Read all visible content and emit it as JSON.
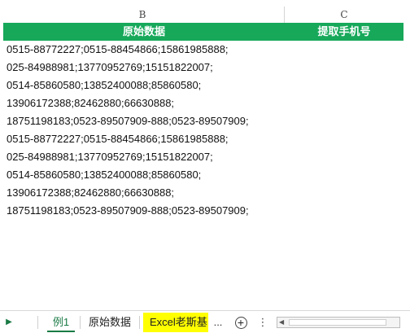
{
  "columns": {
    "b": "B",
    "c": "C"
  },
  "header": {
    "original": "原始数据",
    "extract": "提取手机号"
  },
  "rows": [
    "0515-88772227;0515-88454866;15861985888;",
    "025-84988981;13770952769;15151822007;",
    "0514-85860580;13852400088;85860580;",
    "13906172388;82462880;66630888;",
    "18751198183;0523-89507909-888;0523-89507909;",
    "0515-88772227;0515-88454866;15861985888;",
    "025-84988981;13770952769;15151822007;",
    "0514-85860580;13852400088;85860580;",
    "13906172388;82462880;66630888;",
    "18751198183;0523-89507909-888;0523-89507909;"
  ],
  "tabs": {
    "active": "例1",
    "second": "原始数据",
    "third": "Excel老斯基",
    "more": "...",
    "add": "+",
    "menu": "⋮"
  },
  "icons": {
    "nav": "play-right-icon",
    "add": "plus-circle-icon",
    "menu": "vertical-dots-icon",
    "scroll_left": "triangle-left-icon"
  },
  "colors": {
    "header_bg": "#17a85a",
    "active_tab": "#1a7a45",
    "highlight_tab": "#ffff00"
  }
}
